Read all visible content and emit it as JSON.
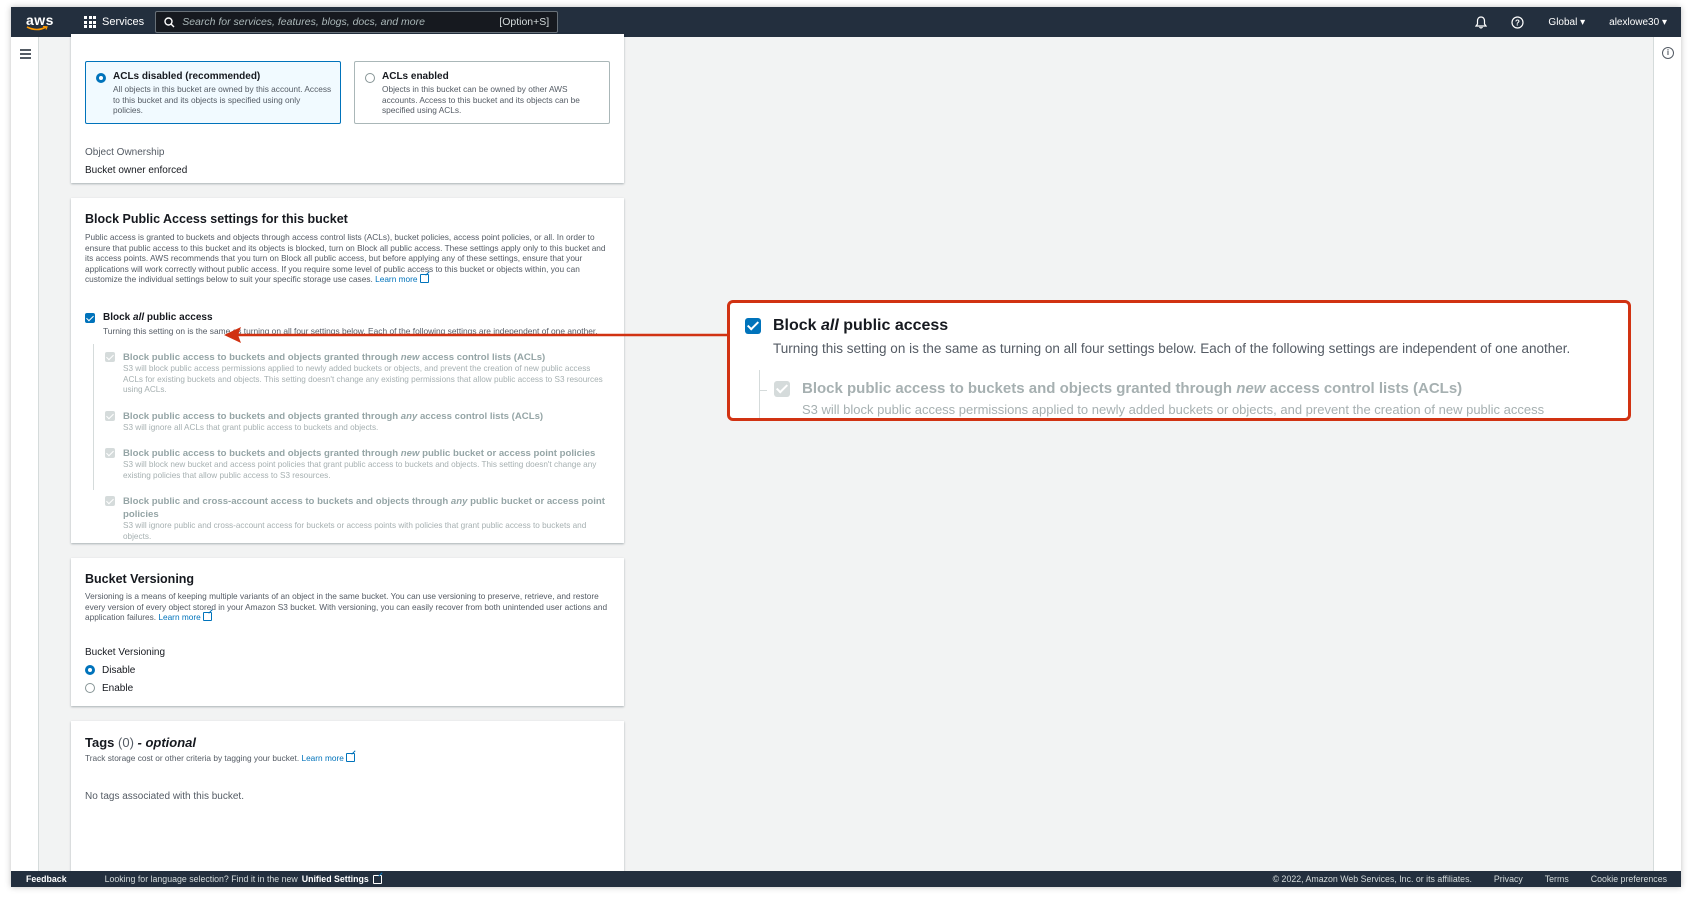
{
  "topnav": {
    "logo_text": "aws",
    "services_label": "Services",
    "search_placeholder": "Search for services, features, blogs, docs, and more",
    "search_shortcut": "[Option+S]",
    "region": "Global",
    "account": "alexlowe30"
  },
  "object_ownership": {
    "tiles": [
      {
        "title": "ACLs disabled (recommended)",
        "description": "All objects in this bucket are owned by this account. Access to this bucket and its objects is specified using only policies.",
        "selected": true
      },
      {
        "title": "ACLs enabled",
        "description": "Objects in this bucket can be owned by other AWS accounts. Access to this bucket and its objects can be specified using ACLs.",
        "selected": false
      }
    ],
    "label": "Object Ownership",
    "value": "Bucket owner enforced"
  },
  "block_public_access": {
    "title": "Block Public Access settings for this bucket",
    "description": "Public access is granted to buckets and objects through access control lists (ACLs), bucket policies, access point policies, or all. In order to ensure that public access to this bucket and its objects is blocked, turn on Block all public access. These settings apply only to this bucket and its access points. AWS recommends that you turn on Block all public access, but before applying any of these settings, ensure that your applications will work correctly without public access. If you require some level of public access to this bucket or objects within, you can customize the individual settings below to suit your specific storage use cases.",
    "learn_more": "Learn more",
    "main_label_pre": "Block ",
    "main_label_em": "all",
    "main_label_post": " public access",
    "main_checked": true,
    "main_description": "Turning this setting on is the same as turning on all four settings below. Each of the following settings are independent of one another.",
    "sub_settings": [
      {
        "title_pre": "Block public access to buckets and objects granted through ",
        "title_em": "new",
        "title_post": " access control lists (ACLs)",
        "description": "S3 will block public access permissions applied to newly added buckets or objects, and prevent the creation of new public access ACLs for existing buckets and objects. This setting doesn't change any existing permissions that allow public access to S3 resources using ACLs."
      },
      {
        "title_pre": "Block public access to buckets and objects granted through ",
        "title_em": "any",
        "title_post": " access control lists (ACLs)",
        "description": "S3 will ignore all ACLs that grant public access to buckets and objects."
      },
      {
        "title_pre": "Block public access to buckets and objects granted through ",
        "title_em": "new",
        "title_post": " public bucket or access point policies",
        "description": "S3 will block new bucket and access point policies that grant public access to buckets and objects. This setting doesn't change any existing policies that allow public access to S3 resources."
      },
      {
        "title_pre": "Block public and cross-account access to buckets and objects through ",
        "title_em": "any",
        "title_post": " public bucket or access point policies",
        "description": "S3 will ignore public and cross-account access for buckets or access points with policies that grant public access to buckets and objects."
      }
    ]
  },
  "callout": {
    "title_pre": "Block ",
    "title_em": "all",
    "title_post": " public access",
    "description": "Turning this setting on is the same as turning on all four settings below. Each of the following settings are independent of one another.",
    "sub_title_pre": "Block public access to buckets and objects granted through ",
    "sub_title_em": "new",
    "sub_title_post": " access control lists (ACLs)",
    "sub_description": "S3 will block public access permissions applied to newly added buckets or objects, and prevent the creation of new public access",
    "border_color": "#d13212"
  },
  "versioning": {
    "title": "Bucket Versioning",
    "description": "Versioning is a means of keeping multiple variants of an object in the same bucket. You can use versioning to preserve, retrieve, and restore every version of every object stored in your Amazon S3 bucket. With versioning, you can easily recover from both unintended user actions and application failures.",
    "learn_more": "Learn more",
    "label": "Bucket Versioning",
    "options": [
      {
        "label": "Disable",
        "selected": true
      },
      {
        "label": "Enable",
        "selected": false
      }
    ]
  },
  "tags": {
    "title": "Tags",
    "count": "(0)",
    "optional": "- optional",
    "description": "Track storage cost or other criteria by tagging your bucket.",
    "learn_more": "Learn more",
    "empty": "No tags associated with this bucket."
  },
  "footer": {
    "feedback": "Feedback",
    "language_text": "Looking for language selection? Find it in the new",
    "unified_settings": "Unified Settings",
    "copyright": "© 2022, Amazon Web Services, Inc. or its affiliates.",
    "privacy": "Privacy",
    "terms": "Terms",
    "cookie": "Cookie preferences"
  },
  "colors": {
    "nav_bg": "#232f3e",
    "accent": "#0073bb",
    "callout_red": "#d13212"
  }
}
